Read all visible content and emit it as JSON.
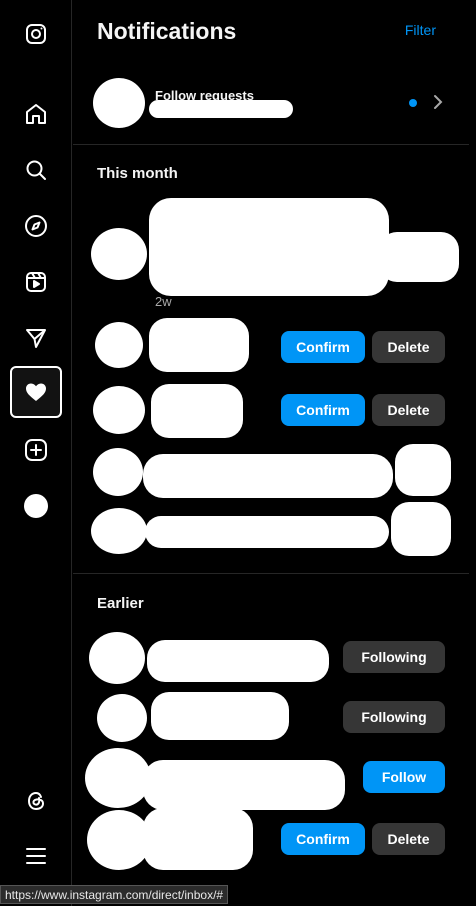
{
  "sidebar": {
    "items": [
      {
        "name": "instagram-logo-icon"
      },
      {
        "name": "home-icon"
      },
      {
        "name": "search-icon"
      },
      {
        "name": "explore-icon"
      },
      {
        "name": "reels-icon"
      },
      {
        "name": "messages-icon"
      },
      {
        "name": "notifications-heart-icon",
        "active": true
      },
      {
        "name": "create-icon"
      },
      {
        "name": "profile-avatar"
      },
      {
        "name": "threads-icon"
      },
      {
        "name": "more-menu-icon"
      }
    ]
  },
  "panel": {
    "title": "Notifications",
    "filter_label": "Filter",
    "follow_requests_label": "Follow requests",
    "this_month_heading": "This month",
    "earlier_heading": "Earlier",
    "timestamp_first": "2w"
  },
  "buttons": {
    "confirm": "Confirm",
    "delete": "Delete",
    "following": "Following",
    "follow": "Follow"
  },
  "colors": {
    "accent": "#0095f6",
    "secondary_button": "#363636",
    "background": "#000000"
  },
  "statusbar": {
    "url": "https://www.instagram.com/direct/inbox/#"
  }
}
